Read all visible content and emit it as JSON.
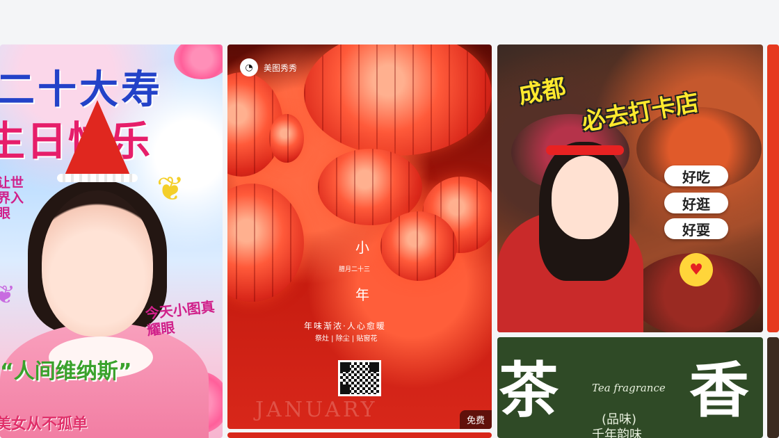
{
  "cards": {
    "birthday": {
      "title_line1": "二十大寿",
      "title_line2": "生日快乐",
      "side_text": "让世界入眼",
      "side_right": "今天小图真耀眼",
      "quote": "“人间维纳斯”",
      "bottom": "美女从不孤单"
    },
    "lantern": {
      "brand": "美图秀秀",
      "char1": "小",
      "date": "腊月二十三",
      "char2": "年",
      "slogan": "年味渐浓·人心愈暖",
      "subline": "祭灶 | 除尘 | 贴窗花",
      "watermark": "JANUARY",
      "badge": "免费"
    },
    "food": {
      "title1": "成都",
      "title2": "必去打卡店",
      "pills": [
        "好吃",
        "好逛",
        "好耍"
      ]
    },
    "tea": {
      "char_left": "茶",
      "char_right": "香",
      "en": "Tea fragrance",
      "pinwei": "(品味)",
      "line": "千年韵味"
    }
  },
  "icons": {
    "brand": "meitu-logo-icon",
    "heart": "heart-hand-icon",
    "butterfly": "butterfly-icon",
    "qr": "qr-code-icon"
  },
  "colors": {
    "background": "#f4f5f7",
    "lantern_red": "#d8271a",
    "tea_green": "#2f4a26",
    "accent_yellow": "#ffe92e"
  }
}
